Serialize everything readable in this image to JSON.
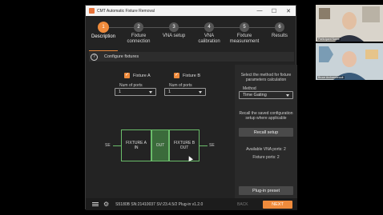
{
  "window": {
    "title": "CMT Automatic Fixture Removal",
    "minimize": "—",
    "maximize": "☐",
    "close": "✕"
  },
  "steps": [
    {
      "num": "1",
      "label": "Description"
    },
    {
      "num": "2",
      "label": "Fixture\nconnection"
    },
    {
      "num": "3",
      "label": "VNA setup"
    },
    {
      "num": "4",
      "label": "VNA\ncalibration"
    },
    {
      "num": "5",
      "label": "Fixture\nmeasurement"
    },
    {
      "num": "6",
      "label": "Results"
    }
  ],
  "section": {
    "help": "?",
    "title": "Configure fixtures"
  },
  "fixtures": {
    "a": {
      "label": "Fixture A",
      "checked": true,
      "ports_caption": "Num of ports",
      "ports_value": "1"
    },
    "b": {
      "label": "Fixture B",
      "checked": true,
      "ports_caption": "Num of ports",
      "ports_value": "1"
    }
  },
  "diagram": {
    "se_left": "SE",
    "se_right": "SE",
    "fixture_a": "FIXTURE A\nIN",
    "out": "OUT",
    "fixture_b": "FIXTURE B\nOUT"
  },
  "right_panel": {
    "method_help": "Select the method for fixture\nparameters calculation",
    "method_caption": "Method",
    "method_value": "Time Gating",
    "recall_help": "Recall the saved configuration\nsetup where applicable",
    "recall_button": "Recall setup",
    "vna_ports": "Available VNA ports: 2",
    "fixture_ports": "Fixture ports: 2",
    "plugin_button": "Plug-in preset"
  },
  "bottom": {
    "device_info": "S5180B SN:21410037 SV:23.4.5/2 Plug-in v1.2.0",
    "back": "BACK",
    "next": "NEXT"
  },
  "participants": [
    {
      "name": "Participant Name"
    },
    {
      "name": "Bruce Archambeault"
    }
  ],
  "colors": {
    "accent": "#ef8b3c",
    "diagram_green": "#6abd6a",
    "background": "#232323"
  }
}
